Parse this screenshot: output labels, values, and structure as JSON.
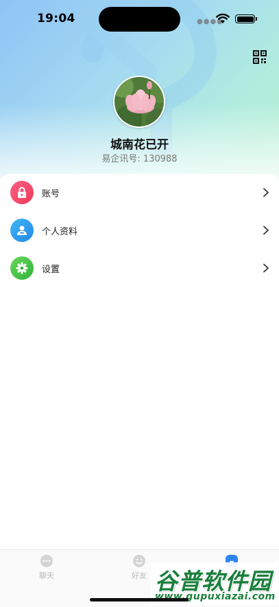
{
  "status_bar": {
    "time": "19:04"
  },
  "header": {
    "qr_icon": "qr-code-icon"
  },
  "profile": {
    "name": "城南花已开",
    "id_text": "易企讯号: 130988"
  },
  "menu": {
    "items": [
      {
        "label": "账号",
        "icon": "lock-icon",
        "color": "#f24b6a"
      },
      {
        "label": "个人资料",
        "icon": "person-icon",
        "color": "#2e9cf0"
      },
      {
        "label": "设置",
        "icon": "gear-icon",
        "color": "#45c64a"
      }
    ]
  },
  "tab_bar": {
    "tabs": [
      {
        "label": "聊天",
        "icon": "chat-icon"
      },
      {
        "label": "好友",
        "icon": "smile-icon"
      },
      {
        "label": "",
        "icon": "me-icon"
      }
    ]
  },
  "watermark": {
    "title": "谷普软件园",
    "url": "www.gupuxiazai.com"
  },
  "colors": {
    "accent": "#2f86f0",
    "header_start": "#8fc3f6",
    "header_end": "#b9f0d3"
  }
}
